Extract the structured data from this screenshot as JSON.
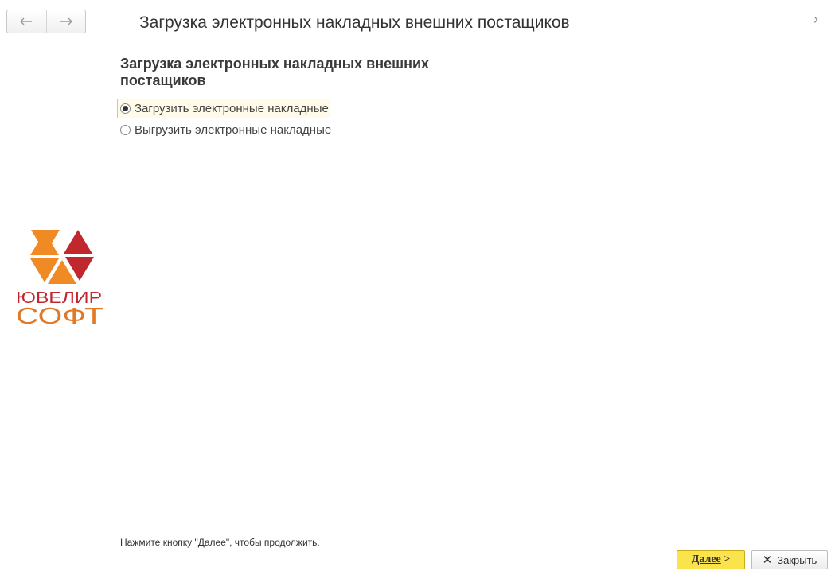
{
  "window": {
    "title": "Загрузка электронных накладных внешних постащиков",
    "more_chevron": "›"
  },
  "nav": {
    "back_icon": "arrow-left-icon",
    "forward_icon": "arrow-right-icon"
  },
  "form": {
    "heading": "Загрузка электронных накладных внешних постащиков",
    "options": [
      {
        "label": "Загрузить электронные накладные",
        "checked": true
      },
      {
        "label": "Выгрузить электронные накладные",
        "checked": false
      }
    ]
  },
  "logo": {
    "line1": "ЮВЕЛИР",
    "line2": "СОФТ",
    "colors": {
      "red": "#c0282d",
      "orange": "#f08a24",
      "text_red": "#c0282d",
      "text_orange": "#e07a28"
    }
  },
  "footer": {
    "hint": "Нажмите кнопку \"Далее\", чтобы продолжить.",
    "next_button": {
      "label": "Далее",
      "suffix": ">"
    },
    "close_button": {
      "icon": "close-icon",
      "label": "Закрыть"
    }
  },
  "colors": {
    "accent_button": "#fbe34c",
    "focus_border": "#e6c766"
  }
}
